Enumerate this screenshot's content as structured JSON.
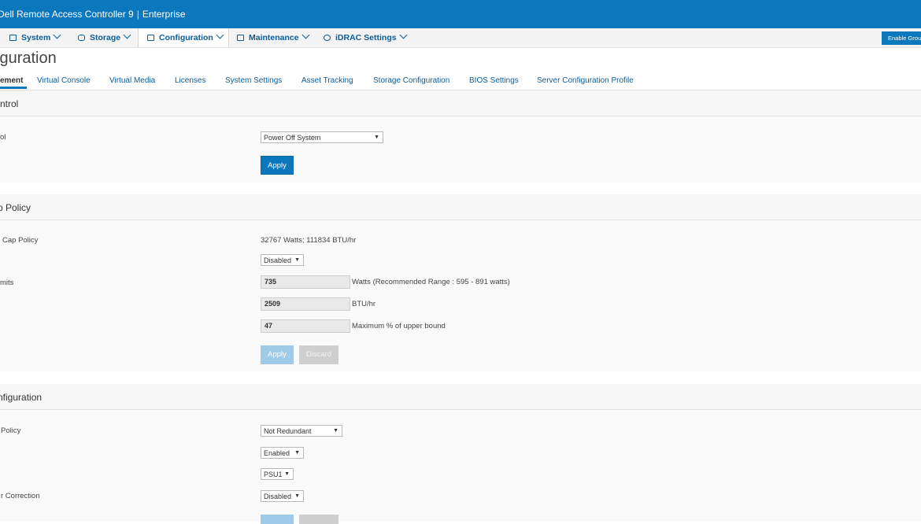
{
  "header": {
    "title": "Dell Remote Access Controller 9",
    "edition": "Enterprise",
    "colors": {
      "accent": "#0b78be",
      "nav_text": "#0b5c98"
    }
  },
  "nav": {
    "items": [
      {
        "label": "System",
        "icon": "server-icon"
      },
      {
        "label": "Storage",
        "icon": "storage-icon"
      },
      {
        "label": "Configuration",
        "icon": "configuration-icon",
        "active": true
      },
      {
        "label": "Maintenance",
        "icon": "maintenance-icon"
      },
      {
        "label": "iDRAC Settings",
        "icon": "settings-icon"
      }
    ],
    "enable_group_label": "Enable Grou"
  },
  "page": {
    "title": "iguration"
  },
  "tabs": [
    "Power Management",
    "Virtual Console",
    "Virtual Media",
    "Licenses",
    "System Settings",
    "Asset Tracking",
    "Storage Configuration",
    "BIOS Settings",
    "Server Configuration Profile"
  ],
  "tabs_visible": [
    "ement",
    "Virtual Console",
    "Virtual Media",
    "Licenses",
    "System Settings",
    "Asset Tracking",
    "Storage Configuration",
    "BIOS Settings",
    "Server Configuration Profile"
  ],
  "power_control": {
    "title": "ntrol",
    "label": "ol",
    "selected": "Power Off System",
    "apply": "Apply"
  },
  "cap_policy": {
    "title": "p Policy",
    "policy_label": "Cap Policy",
    "policy_value": "32767 Watts; 111834 BTU/hr",
    "enabled_selected": "Disabled",
    "limits_label": "mits",
    "watts_value": "735",
    "watts_note": "Watts (Recommended Range : 595 - 891 watts)",
    "btu_value": "2509",
    "btu_note": "BTU/hr",
    "pct_value": "47",
    "pct_note": "Maximum % of upper bound",
    "apply": "Apply",
    "discard": "Discard"
  },
  "psu_config": {
    "title": "nfiguration",
    "redundancy_label": "Policy",
    "redundancy_selected": "Not Redundant",
    "hot_spare_selected": "Enabled",
    "primary_psu_selected": "PSU1",
    "pf_label": "r Correction",
    "pf_selected": "Disabled"
  }
}
